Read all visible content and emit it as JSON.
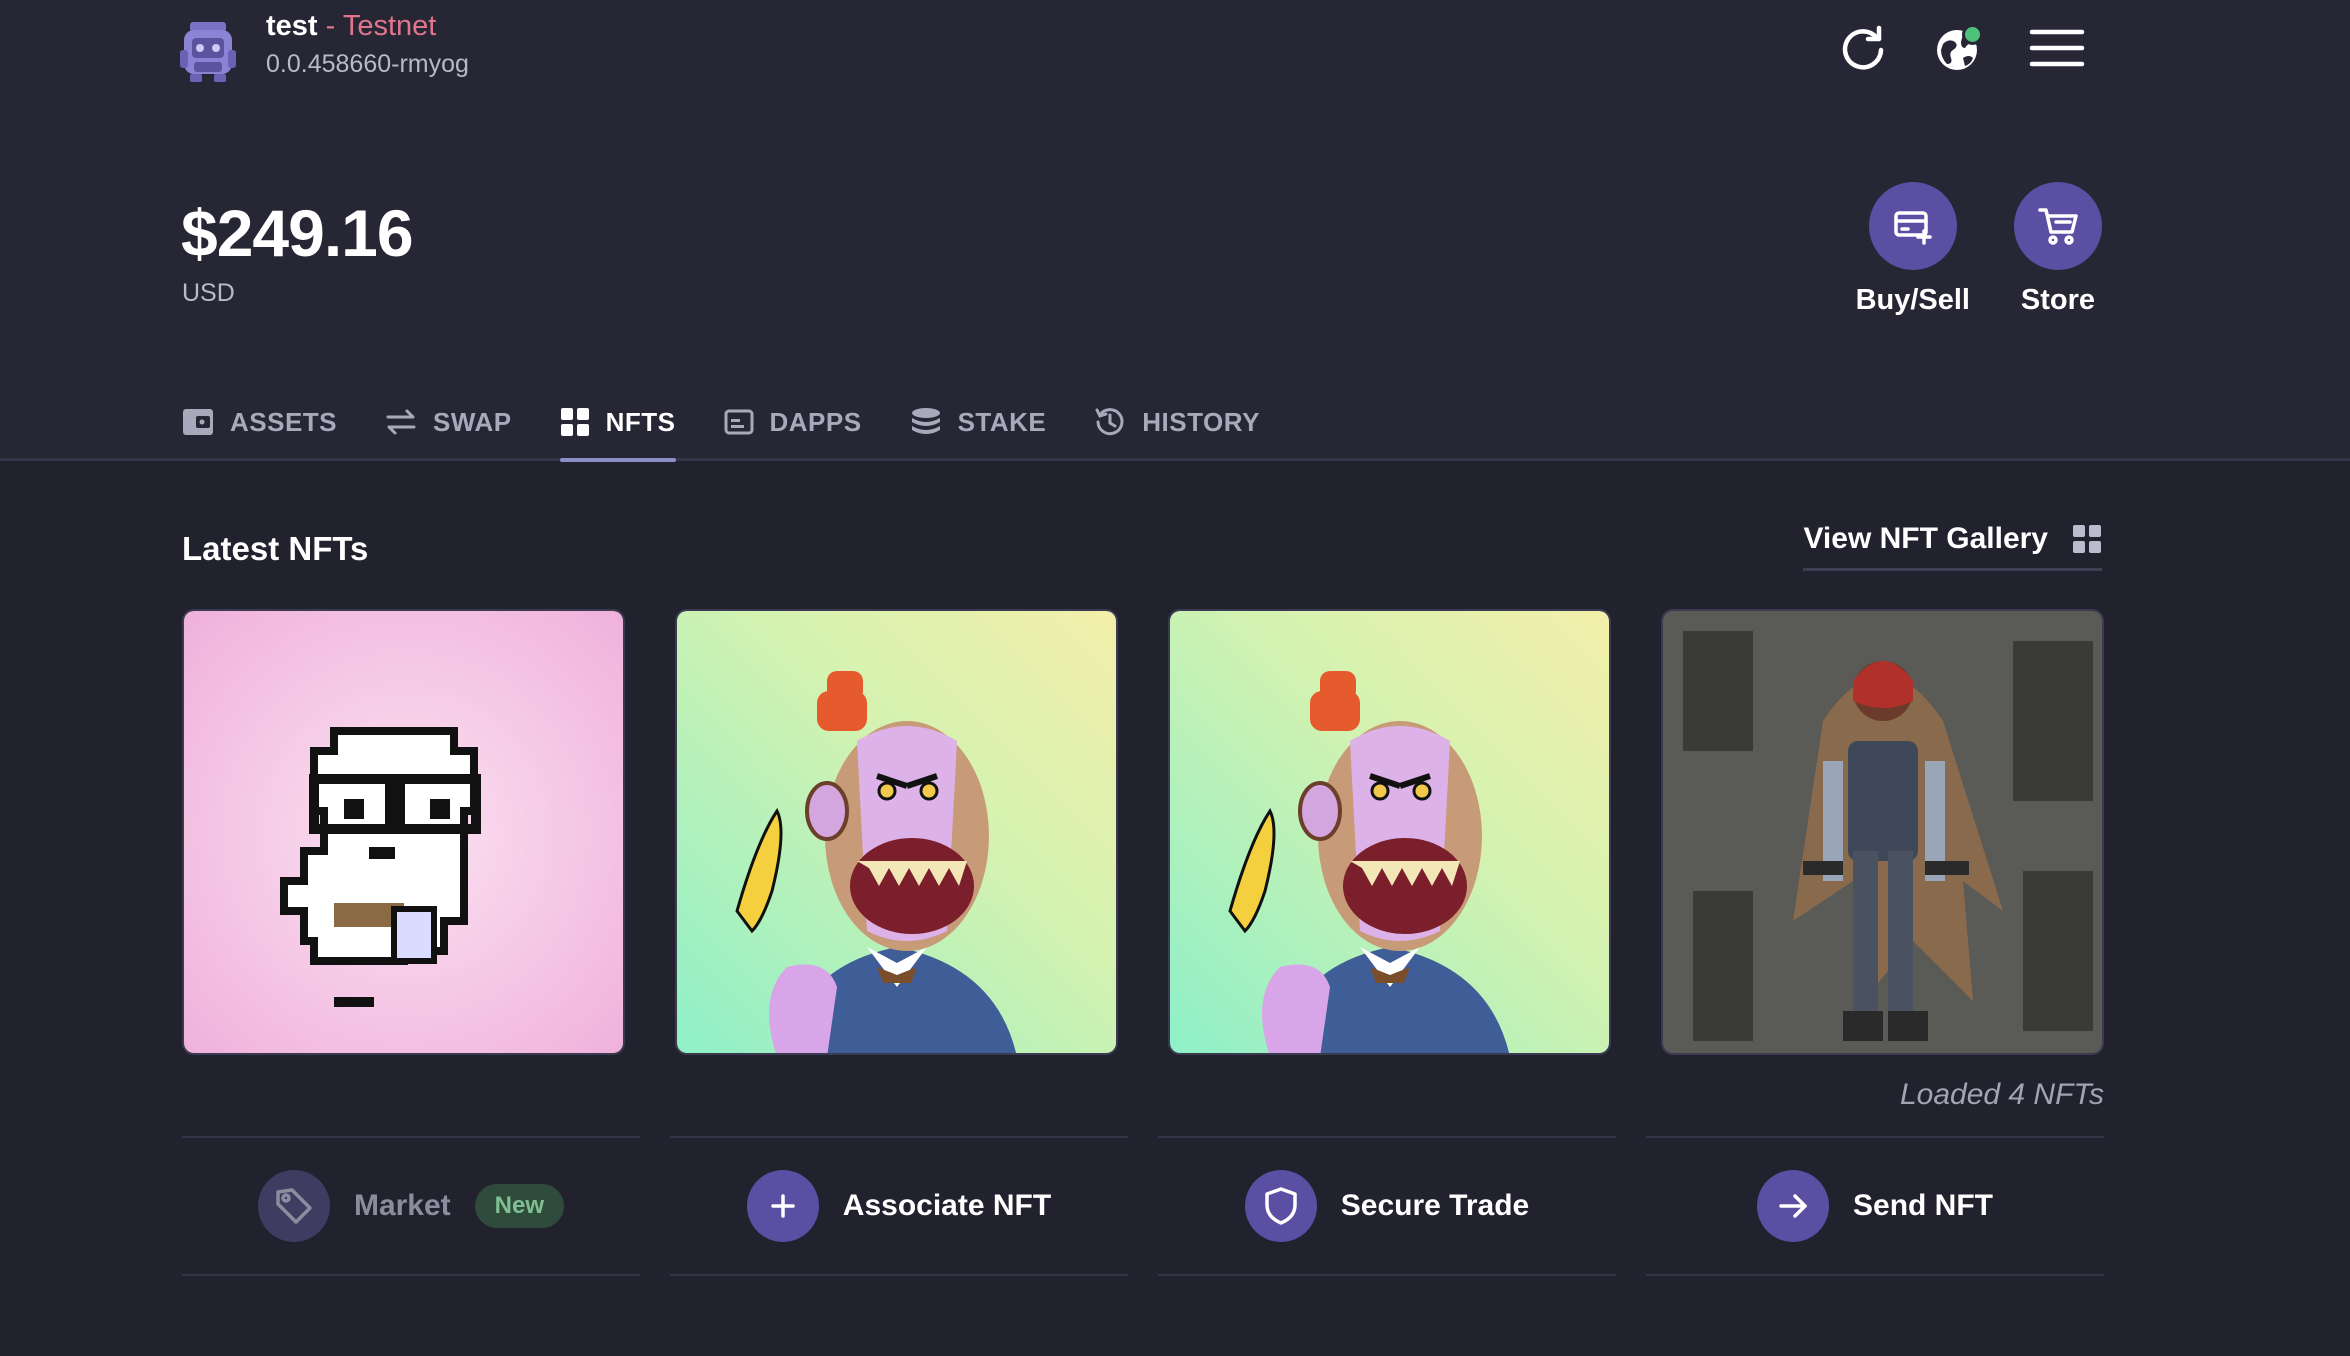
{
  "account": {
    "name": "test",
    "separator": " - ",
    "network": "Testnet",
    "id": "0.0.458660-rmyog"
  },
  "header_icons": [
    "refresh-icon",
    "globe-icon",
    "menu-icon"
  ],
  "balance": {
    "amount": "$249.16",
    "currency": "USD"
  },
  "actions": [
    {
      "label": "Buy/Sell",
      "icon": "card-plus-icon"
    },
    {
      "label": "Store",
      "icon": "cart-icon"
    }
  ],
  "tabs": [
    {
      "label": "ASSETS",
      "icon": "wallet-icon",
      "active": false
    },
    {
      "label": "SWAP",
      "icon": "swap-icon",
      "active": false
    },
    {
      "label": "NFTS",
      "icon": "grid-icon",
      "active": true
    },
    {
      "label": "DAPPS",
      "icon": "dapps-icon",
      "active": false
    },
    {
      "label": "STAKE",
      "icon": "stack-icon",
      "active": false
    },
    {
      "label": "HISTORY",
      "icon": "history-icon",
      "active": false
    }
  ],
  "nft_section": {
    "title": "Latest NFTs",
    "gallery_link": "View NFT Gallery",
    "loaded_text": "Loaded 4 NFTs"
  },
  "nfts": [
    {
      "image": "pixel-ghost-with-glasses",
      "bg": "#f2b6dd"
    },
    {
      "image": "ape-with-banana",
      "bg": "#b9efc1"
    },
    {
      "image": "ape-with-banana",
      "bg": "#b9efc1"
    },
    {
      "image": "hooded-gunslinger",
      "bg": "#5a5a58"
    }
  ],
  "bottom_actions": [
    {
      "label": "Market",
      "badge": "New",
      "icon": "tag-icon",
      "enabled": false
    },
    {
      "label": "Associate NFT",
      "icon": "plus-icon",
      "enabled": true
    },
    {
      "label": "Secure Trade",
      "icon": "shield-icon",
      "enabled": true
    },
    {
      "label": "Send NFT",
      "icon": "arrow-right-icon",
      "enabled": true
    }
  ],
  "colors": {
    "background": "#22222f",
    "header": "#262635",
    "accent": "#5a4fa3",
    "testnet": "#e0758c",
    "status_online": "#4ec27a"
  }
}
